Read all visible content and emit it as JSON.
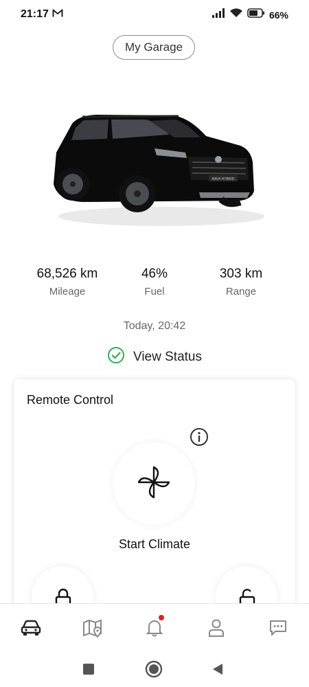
{
  "status_bar": {
    "time": "21:17",
    "battery_text": "66%",
    "icons": [
      "gmail-icon",
      "signal-icon",
      "wifi-icon",
      "battery-icon"
    ]
  },
  "header": {
    "garage_button_label": "My Garage"
  },
  "vehicle": {
    "image": "car-image",
    "model_badge": "RAV4 HYBRID",
    "color": "#0b0b0b"
  },
  "stats": [
    {
      "value": "68,526 km",
      "label": "Mileage"
    },
    {
      "value": "46%",
      "label": "Fuel"
    },
    {
      "value": "303 km",
      "label": "Range"
    }
  ],
  "status": {
    "timestamp": "Today, 20:42",
    "view_status_label": "View Status",
    "status_color": "#3aa655"
  },
  "remote_control": {
    "title": "Remote Control",
    "info_icon": "info-icon",
    "climate_label": "Start Climate",
    "lock_icon": "lock-icon",
    "unlock_icon": "unlock-icon"
  },
  "bottom_nav": {
    "items": [
      {
        "icon": "car-icon",
        "active": true
      },
      {
        "icon": "map-icon",
        "active": false
      },
      {
        "icon": "bell-icon",
        "active": false,
        "badge": true
      },
      {
        "icon": "profile-icon",
        "active": false
      },
      {
        "icon": "chat-icon",
        "active": false
      }
    ],
    "badge_color": "#e0202a"
  },
  "system_nav": {
    "buttons": [
      "recents-button",
      "home-button",
      "back-button"
    ]
  }
}
